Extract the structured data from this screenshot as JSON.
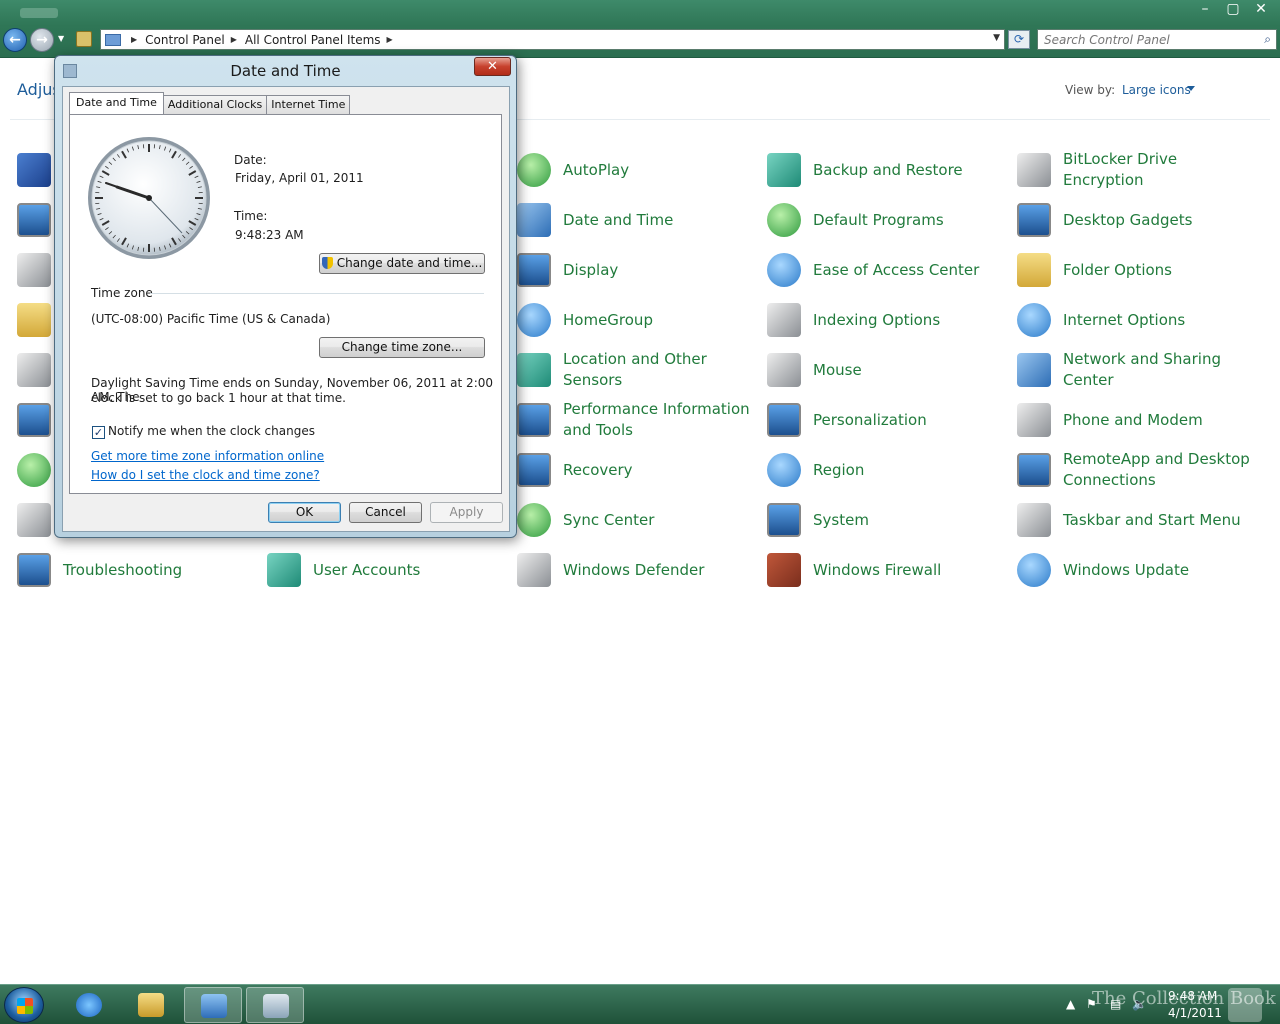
{
  "window": {
    "min": "–",
    "max": "▢",
    "close": "✕"
  },
  "address_bar": {
    "crumbs": [
      "Control Panel",
      "All Control Panel Items"
    ],
    "search_placeholder": "Search Control Panel"
  },
  "header": {
    "title_partial": "Adjust",
    "view_by_label": "View by:",
    "view_by_value": "Large icons"
  },
  "items": [
    {
      "label": "AutoPlay",
      "icon": "autoplay-icon",
      "col": 2
    },
    {
      "label": "Backup and Restore",
      "icon": "backup-icon",
      "col": 3
    },
    {
      "label": "BitLocker Drive Encryption",
      "icon": "bitlocker-icon",
      "col": 4
    },
    {
      "label": "Date and Time",
      "icon": "date-time-icon",
      "col": 2
    },
    {
      "label": "Default Programs",
      "icon": "default-programs-icon",
      "col": 3
    },
    {
      "label": "Desktop Gadgets",
      "icon": "gadgets-icon",
      "col": 4
    },
    {
      "label": "Display",
      "icon": "display-icon",
      "col": 2
    },
    {
      "label": "Ease of Access Center",
      "icon": "ease-access-icon",
      "col": 3
    },
    {
      "label": "Folder Options",
      "icon": "folder-options-icon",
      "col": 4
    },
    {
      "label": "HomeGroup",
      "icon": "homegroup-icon",
      "col": 2
    },
    {
      "label": "Indexing Options",
      "icon": "indexing-icon",
      "col": 3
    },
    {
      "label": "Internet Options",
      "icon": "internet-options-icon",
      "col": 4
    },
    {
      "label": "Location and Other Sensors",
      "icon": "location-icon",
      "col": 2
    },
    {
      "label": "Mouse",
      "icon": "mouse-icon",
      "col": 3
    },
    {
      "label": "Network and Sharing Center",
      "icon": "network-icon",
      "col": 4
    },
    {
      "label": "Performance Information and Tools",
      "icon": "performance-icon",
      "col": 2
    },
    {
      "label": "Personalization",
      "icon": "personalization-icon",
      "col": 3
    },
    {
      "label": "Phone and Modem",
      "icon": "phone-icon",
      "col": 4
    },
    {
      "label": "Recovery",
      "icon": "recovery-icon",
      "col": 2
    },
    {
      "label": "Region",
      "icon": "region-icon",
      "col": 3
    },
    {
      "label": "RemoteApp and Desktop Connections",
      "icon": "remoteapp-icon",
      "col": 4
    },
    {
      "label": "Sync Center",
      "icon": "sync-icon",
      "col": 2
    },
    {
      "label": "System",
      "icon": "system-icon",
      "col": 3
    },
    {
      "label": "Taskbar and Start Menu",
      "icon": "taskbar-icon",
      "col": 4
    },
    {
      "label": "Troubleshooting",
      "icon": "troubleshooting-icon",
      "col": 0
    },
    {
      "label": "User Accounts",
      "icon": "user-accounts-icon",
      "col": 1
    },
    {
      "label": "Windows Defender",
      "icon": "defender-icon",
      "col": 2
    },
    {
      "label": "Windows Firewall",
      "icon": "firewall-icon",
      "col": 3
    },
    {
      "label": "Windows Update",
      "icon": "update-icon",
      "col": 4
    }
  ],
  "dialog": {
    "title": "Date and Time",
    "tabs": [
      "Date and Time",
      "Additional Clocks",
      "Internet Time"
    ],
    "date_label": "Date:",
    "date_value": "Friday, April 01, 2011",
    "time_label": "Time:",
    "time_value": "9:48:23 AM",
    "change_date_button": "Change date and time...",
    "timezone_label": "Time zone",
    "timezone_value": "(UTC-08:00) Pacific Time (US & Canada)",
    "change_tz_button": "Change time zone...",
    "dst_line1": "Daylight Saving Time ends on Sunday, November 06, 2011 at 2:00 AM. The",
    "dst_line2": "clock is set to go back 1 hour at that time.",
    "notify_label": "Notify me when the clock changes",
    "notify_checked": true,
    "link1": "Get more time zone information online",
    "link2": "How do I set the clock and time zone?",
    "ok": "OK",
    "cancel": "Cancel",
    "apply": "Apply"
  },
  "taskbar": {
    "time": "9:48 AM",
    "date": "4/1/2011",
    "watermark": "The Collection Book"
  },
  "colors": {
    "link_green": "#217b3c",
    "link_blue": "#0066cc",
    "chrome_green": "#2f7656"
  }
}
